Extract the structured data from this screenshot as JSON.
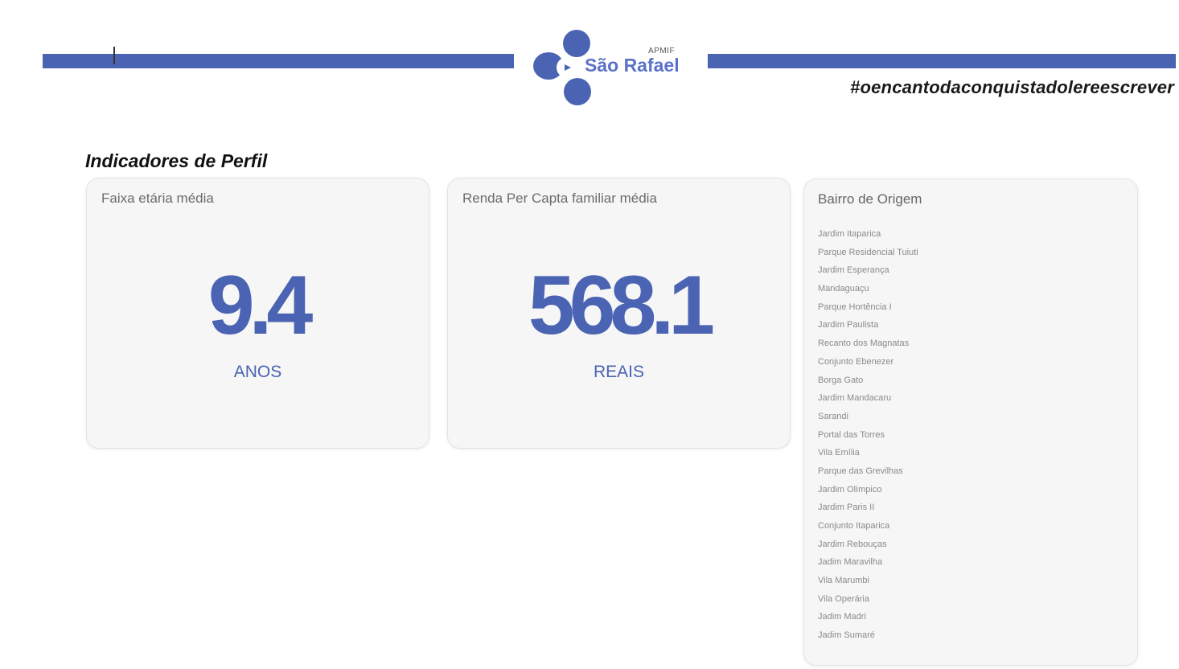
{
  "header": {
    "brand_small": "APMIF",
    "brand_name": "São Rafael",
    "hashtag": "#oencantodaconquistadolereescrever",
    "accent_color": "#4a63b2"
  },
  "section": {
    "title": "Indicadores de Perfil"
  },
  "cards": [
    {
      "label": "Faixa etária média",
      "value": "9.4",
      "unit": "ANOS"
    },
    {
      "label": "Renda Per Capta familiar média",
      "value": "568.1",
      "unit": "REAIS"
    }
  ],
  "neighborhoods": {
    "title": "Bairro de Origem",
    "items": [
      "Jardim Itaparica",
      "Parque Residencial Tuiuti",
      "Jardim Esperança",
      "Mandaguaçu",
      "Parque Hortência I",
      "Jardim Paulista",
      "Recanto dos Magnatas",
      "Conjunto Ebenezer",
      "Borga Gato",
      "Jardim Mandacaru",
      "Sarandi",
      "Portal das Torres",
      "Vila Emília",
      "Parque das Grevilhas",
      "Jardim Olímpico",
      "Jardim Paris II",
      "Conjunto Itaparica",
      "Jardim Rebouças",
      "Jadim Maravilha",
      "Vila Marumbi",
      "Vila Operária",
      "Jadim Madri",
      "Jadim Sumaré"
    ]
  }
}
